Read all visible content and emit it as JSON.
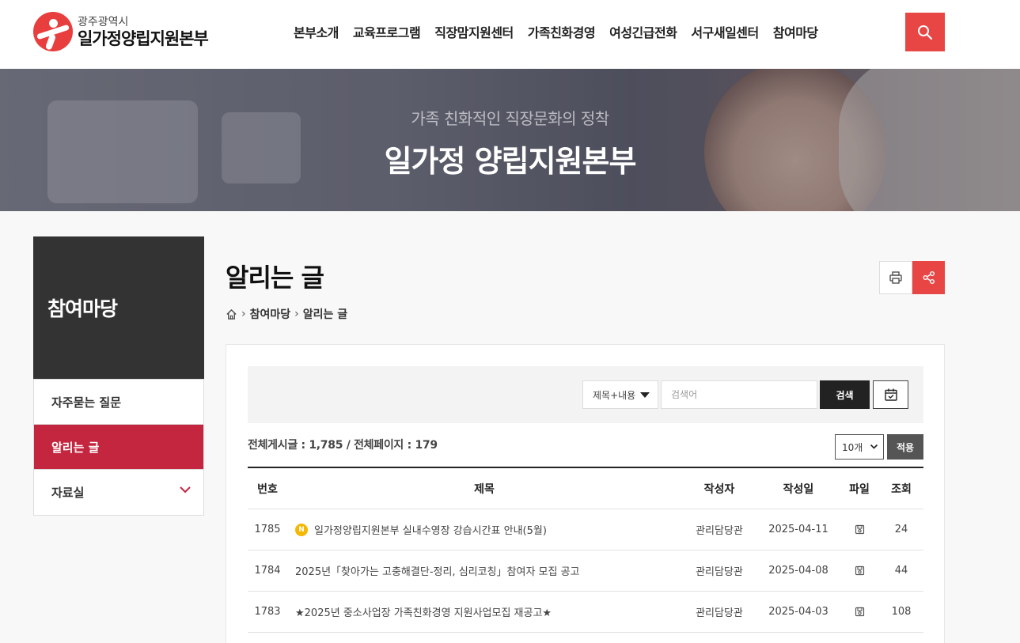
{
  "header": {
    "logo_sub": "광주광역시",
    "logo_main": "일가정양립지원본부",
    "nav": [
      "본부소개",
      "교육프로그램",
      "직장맘지원센터",
      "가족친화경영",
      "여성긴급전화",
      "서구새일센터",
      "참여마당"
    ],
    "accent": "#e84545"
  },
  "banner": {
    "subtitle": "가족 친화적인 직장문화의 정착",
    "title": "일가정 양립지원본부"
  },
  "sidebar": {
    "title": "참여마당",
    "items": [
      {
        "label": "자주묻는 질문"
      },
      {
        "label": "알리는 글"
      },
      {
        "label": "자료실"
      }
    ],
    "active_color": "#c4253f"
  },
  "page": {
    "title": "알리는 글",
    "breadcrumb": [
      "참여마당",
      "알리는 글"
    ]
  },
  "search": {
    "field_option": "제목+내용",
    "keyword_placeholder": "검색어",
    "submit_label": "검색"
  },
  "list_info": {
    "count_text": "전체게시글 : 1,785 / 전체페이지 : 179",
    "per_page": "10개",
    "apply_label": "적용"
  },
  "table": {
    "headers": [
      "번호",
      "제목",
      "작성자",
      "작성일",
      "파일",
      "조회"
    ],
    "rows": [
      {
        "num": "1785",
        "notice_badge": "N",
        "title": "일가정양립지원본부 실내수영장 강습시간표 안내(5월)",
        "writer": "관리담당관",
        "date": "2025-04-11",
        "views": "24"
      },
      {
        "num": "1784",
        "title": "2025년「찾아가는 고충해결단-정리, 심리코칭」참여자 모집 공고",
        "writer": "관리담당관",
        "date": "2025-04-08",
        "views": "44"
      },
      {
        "num": "1783",
        "title": "★2025년 중소사업장 가족친화경영 지원사업모집 재공고★",
        "writer": "관리담당관",
        "date": "2025-04-03",
        "views": "108"
      }
    ]
  }
}
